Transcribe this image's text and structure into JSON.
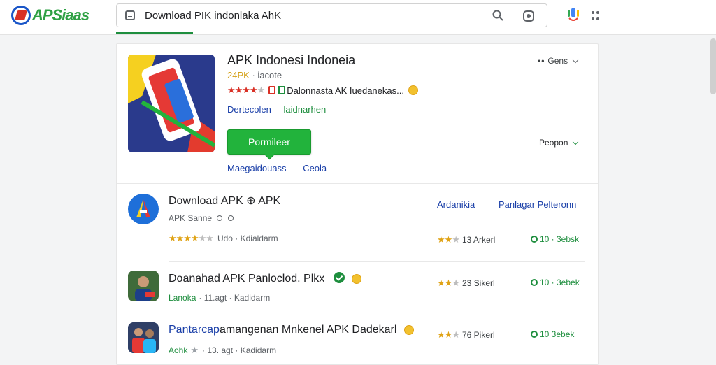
{
  "header": {
    "logo_text": "APSiaas",
    "search_value": "Download PIK indonlaka AhK",
    "colors": {
      "accent_green": "#1e8e3e",
      "brand_red": "#d93025",
      "brand_blue": "#1a56c8"
    }
  },
  "featured": {
    "title": "APK Indonesi Indoneia",
    "subtitle_count": "24PK",
    "subtitle_rest": "· iacote",
    "rating_text": "Dalonnasta AK Iuedanekas...",
    "link_primary": "Dertecolen",
    "link_secondary": "laidnarhen",
    "install_label": "Pormileer",
    "sublink_1": "Maegaidouass",
    "sublink_2": "Ceola",
    "menu_label": "Gens",
    "popular_label": "Peopon"
  },
  "list": [
    {
      "title": "Download  APK ⊕ APK",
      "sub": "APK Sanne",
      "meta": "Udo  · Kdialdarm",
      "tag_1": "Ardanikia",
      "tag_2": "Panlagar Pelteronn",
      "rating": "13  Arkerl",
      "downloads": "10 · 3ebsk"
    },
    {
      "title": "Doanahad APK Panloclod. Plkx",
      "meta_green": "Lanoka",
      "meta": "· 11.agt  · Kadidarm",
      "rating": "23  Sikerl",
      "downloads": "10 · 3ebek"
    },
    {
      "title": "Pantarcap",
      "title_rest": "amangenan Mnkenel APK Dadekarl",
      "meta_green": "Aohk",
      "meta": "· 13. agt  · Kadidarm",
      "rating": "76  Pikerl",
      "downloads": "10  3ebek"
    }
  ]
}
